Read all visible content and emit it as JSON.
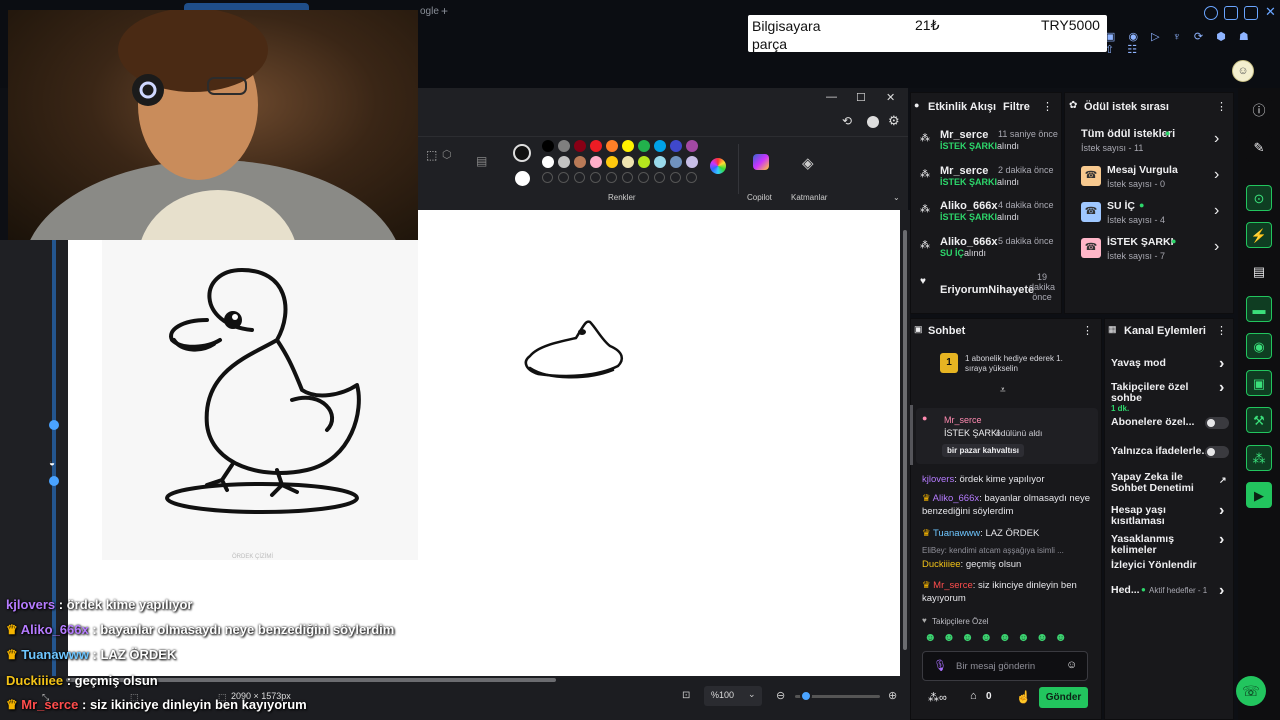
{
  "browser": {
    "tab_hint": "ogle",
    "new_tab": "+"
  },
  "goal_overlay": {
    "item": "Bilgisayara parça",
    "amount": "21₺",
    "goal": "TRY5000"
  },
  "paint": {
    "ribbon": {
      "colors_label": "Renkler",
      "copilot_label": "Copilot",
      "layers_label": "Katmanlar"
    },
    "window_buttons": {
      "minimize": "—",
      "maximize": "☐",
      "close": "✕"
    },
    "palette": [
      "#000000",
      "#7f7f7f",
      "#880015",
      "#ed1c24",
      "#ff7f27",
      "#fff200",
      "#22b14c",
      "#00a2e8",
      "#3f48cc",
      "#a349a4",
      "#ffffff",
      "#c3c3c3",
      "#b97a57",
      "#ffaec9",
      "#ffc90e",
      "#efe4b0",
      "#b5e61d",
      "#99d9ea",
      "#7092be",
      "#c8bfe7"
    ],
    "status": {
      "dimensions": "2090 × 1573px",
      "zoom": "%100"
    },
    "reference_caption": "ÖRDEK ÇİZİMİ"
  },
  "activity": {
    "title": "Etkinlik Akışı",
    "filter": "Filtre",
    "events": [
      {
        "user": "Mr_serce",
        "time": "11 saniye önce",
        "reward": "İSTEK ŞARKI",
        "suffix": "alındı"
      },
      {
        "user": "Mr_serce",
        "time": "2 dakika önce",
        "reward": "İSTEK ŞARKI",
        "suffix": "alındı"
      },
      {
        "user": "Aliko_666x",
        "time": "4 dakika önce",
        "reward": "İSTEK ŞARKI",
        "suffix": "alındı"
      },
      {
        "user": "Aliko_666x",
        "time": "5 dakika önce",
        "reward": "SU İÇ",
        "suffix": "alındı"
      },
      {
        "user": "EriyorumNihayete",
        "time": "19 dakika önce",
        "reward": "",
        "suffix": ""
      }
    ]
  },
  "rewards": {
    "title": "Ödül istek sırası",
    "all_label": "Tüm ödül istekleri",
    "all_count": "İstek sayısı - 11",
    "items": [
      {
        "name": "Mesaj Vurgula",
        "count": "İstek sayısı - 0",
        "dot": false
      },
      {
        "name": "SU İÇ",
        "count": "İstek sayısı - 4",
        "dot": true
      },
      {
        "name": "İSTEK ŞARKI",
        "count": "İstek sayısı - 7",
        "dot": true
      }
    ]
  },
  "chat": {
    "title": "Sohbet",
    "sub_banner": "1 abonelik hediye ederek 1. sıraya yükselin",
    "sub_banner_num": "1",
    "redeem": {
      "user": "Mr_serce",
      "reward": "İSTEK ŞARKI",
      "suffix": "ödülünü aldı",
      "song": "bir pazar kahvaltısı"
    },
    "messages": [
      {
        "user": "kjlovers",
        "color": "#b57bff",
        "badge": false,
        "text": "ördek kime yapılıyor"
      },
      {
        "user": "Aliko_666x",
        "color": "#b57bff",
        "badge": true,
        "text": "bayanlar olmasaydı neye benzediğini söylerdim"
      },
      {
        "user": "Tuanawww",
        "color": "#6ec6ff",
        "badge": true,
        "text": "LAZ ÖRDEK"
      },
      {
        "user": "Duckiiiee",
        "color": "#f3c318",
        "badge": false,
        "text": "geçmiş olsun",
        "reply": "EliBey: kendimi atcam aşşağıya isimli ..."
      },
      {
        "user": "Mr_serce",
        "color": "#ff4d4d",
        "badge": true,
        "text": "siz ikinciye dinleyin ben kayıyorum"
      }
    ],
    "followers_only": "Takipçilere Özel",
    "input_placeholder": "Bir mesaj gönderin",
    "points": "0",
    "send": "Gönder"
  },
  "channel_actions": {
    "title": "Kanal Eylemleri",
    "items": [
      {
        "label": "Yavaş mod",
        "kind": "chevron"
      },
      {
        "label": "Takipçilere özel sohbe",
        "sub": "1 dk.",
        "kind": "chevron"
      },
      {
        "label": "Abonelere özel...",
        "kind": "toggle"
      },
      {
        "label": "Yalnızca ifadelerle...",
        "kind": "toggle"
      },
      {
        "label": "Yapay Zeka ile Sohbet Denetimi",
        "kind": "link"
      },
      {
        "label": "Hesap yaşı kısıtlaması",
        "kind": "chevron"
      },
      {
        "label": "Yasaklanmış kelimeler",
        "kind": "chevron"
      },
      {
        "label": "İzleyici Yönlendir",
        "kind": "none"
      },
      {
        "label": "Hed...",
        "sub": "Aktif hedefler - 1",
        "kind": "chevron"
      }
    ]
  },
  "stream_overlay_chat": [
    {
      "user": "kjlovers",
      "color": "#b57bff",
      "badge": false,
      "text": "ördek kime yapılıyor"
    },
    {
      "user": "Aliko_666x",
      "color": "#b57bff",
      "badge": true,
      "text": "bayanlar olmasaydı neye benzediğini söylerdim"
    },
    {
      "user": "Tuanawww",
      "color": "#6ec6ff",
      "badge": true,
      "text": "LAZ ÖRDEK"
    },
    {
      "user": "Duckiiiee",
      "color": "#f3c318",
      "badge": false,
      "text": "geçmiş olsun"
    },
    {
      "user": "Mr_serce",
      "color": "#ff4d4d",
      "badge": true,
      "text": "siz ikinciye dinleyin ben kayıyorum"
    }
  ]
}
